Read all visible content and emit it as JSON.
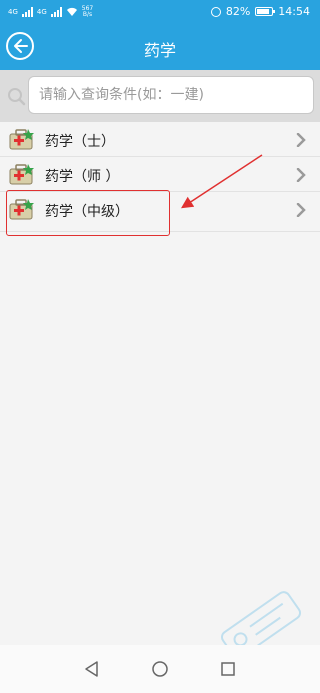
{
  "status_bar": {
    "network": "4G",
    "speed_value": "567",
    "speed_unit": "B/s",
    "battery_percent": "82%",
    "battery_level": 0.82,
    "time": "14:54"
  },
  "header": {
    "title": "药学",
    "background_color": "#29a3df"
  },
  "search": {
    "placeholder": "请输入查询条件(如：一建)",
    "value": ""
  },
  "list": {
    "items": [
      {
        "label": "药学（士）"
      },
      {
        "label": "药学（师 ）"
      },
      {
        "label": "药学（中级）",
        "highlighted": true
      }
    ]
  },
  "annotation": {
    "color": "#e03030"
  },
  "icons": {
    "back": "back-arrow-icon",
    "search": "search-icon",
    "item": "medical-kit-icon",
    "chevron": "chevron-right-icon"
  }
}
